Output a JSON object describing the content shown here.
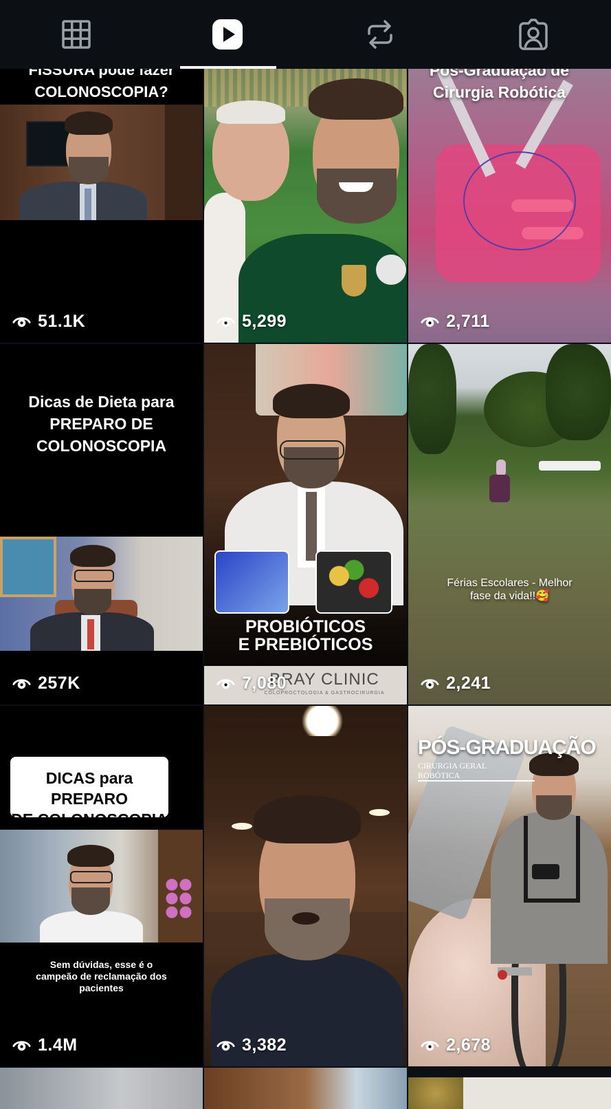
{
  "tabs": [
    {
      "name": "grid-icon"
    },
    {
      "name": "reels-icon",
      "active": true
    },
    {
      "name": "reposts-icon"
    },
    {
      "name": "tagged-icon"
    }
  ],
  "tiles": [
    {
      "title": "FISSURA pode fazer\nCOLONOSCOPIA?",
      "views": "51.1K"
    },
    {
      "title": "",
      "views": "5,299"
    },
    {
      "title": "Pós-Graduação de\nCirurgia Robótica",
      "views": "2,711"
    },
    {
      "title": "Dicas de Dieta para\nPREPARO DE\nCOLONOSCOPIA",
      "views": "257K"
    },
    {
      "title": "PROBIÓTICOS\nE PREBIÓTICOS",
      "brand": "BRAY CLINIC",
      "brand_sub": "COLOPROCTOLOGIA & GASTROCIRURGIA",
      "views": "7,080"
    },
    {
      "title": "Férias Escolares - Melhor\nfase da vida!!🥰",
      "views": "2,241"
    },
    {
      "title": "DICAS para PREPARO\nDE COLONOSCOPIA",
      "caption": "Sem dúvidas, esse é o\ncampeão de reclamação dos\npacientes",
      "views": "1.4M"
    },
    {
      "title": "",
      "views": "3,382"
    },
    {
      "title": "PÓS-GRADUAÇÃO",
      "subtitle": "CIRURGIA GERAL\nROBÓTICA",
      "views": "2,678"
    }
  ],
  "colors": {
    "background": "#0c1014",
    "accent": "#f5f5f5"
  }
}
